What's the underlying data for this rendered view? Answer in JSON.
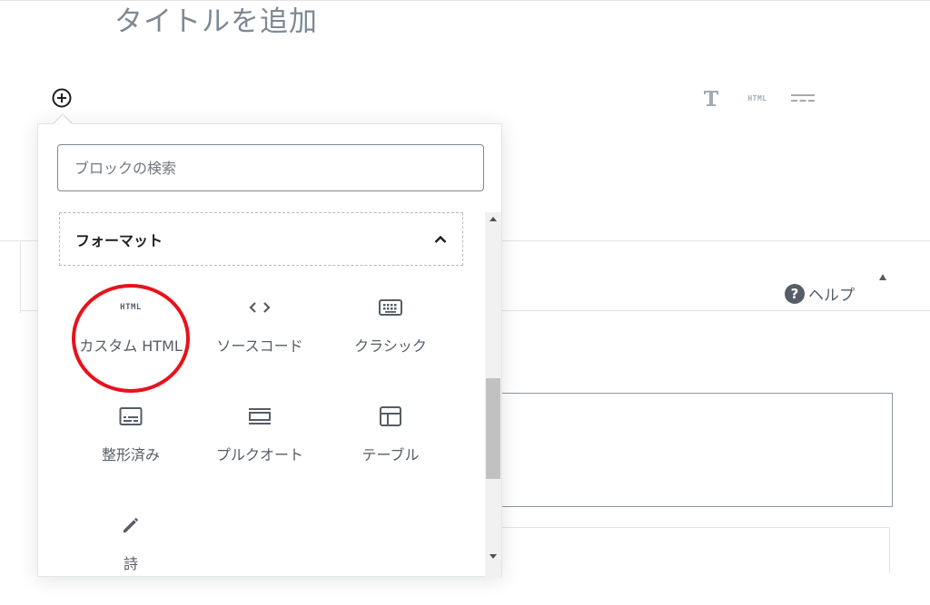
{
  "editor": {
    "title_placeholder": "タイトルを追加",
    "quick_inserter": [
      {
        "icon": "heading-T-icon",
        "label": "T"
      },
      {
        "icon": "html-icon",
        "label": "HTML"
      },
      {
        "icon": "more-divider-icon",
        "label": ""
      }
    ],
    "help_label": "ヘルプ",
    "help_badge": "?"
  },
  "inserter": {
    "search": {
      "placeholder": "ブロックの検索",
      "value": ""
    },
    "panel": {
      "title": "フォーマット",
      "expanded": true
    },
    "html_badge": "HTML",
    "blocks": [
      {
        "label": "カスタム HTML",
        "icon": "html-icon"
      },
      {
        "label": "ソースコード",
        "icon": "code-icon"
      },
      {
        "label": "クラシック",
        "icon": "keyboard-icon"
      },
      {
        "label": "整形済み",
        "icon": "preformatted-icon"
      },
      {
        "label": "プルクオート",
        "icon": "pullquote-icon"
      },
      {
        "label": "テーブル",
        "icon": "table-icon"
      },
      {
        "label": "詩",
        "icon": "pencil-icon"
      }
    ],
    "highlight_color": "#e8121b"
  },
  "colors": {
    "title_text": "#7e8993",
    "icon_gray": "#555d66",
    "quick_inserter_gray": "#a2aab2"
  }
}
